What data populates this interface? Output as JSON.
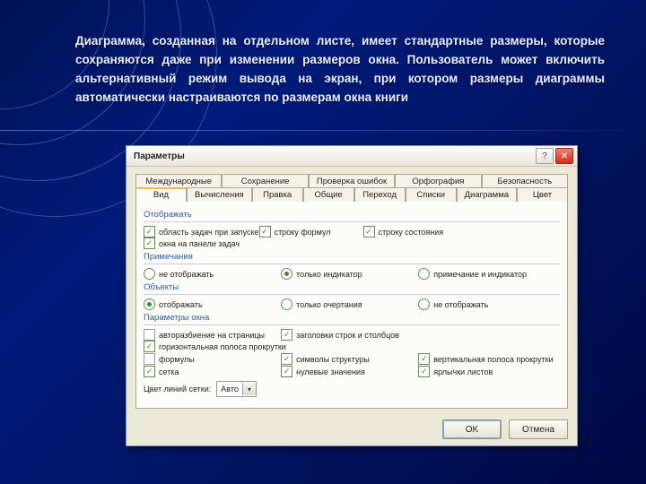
{
  "caption": "Диаграмма, созданная на отдельном листе, имеет стандартные размеры, которые сохраняются даже при изменении размеров окна. Пользователь может включить альтернативный режим вывода на экран, при котором размеры диаграммы автоматически настраиваются по размерам окна книги",
  "dialog": {
    "title": "Параметры",
    "help": "?",
    "close": "✕",
    "tabs_row1": [
      "Международные",
      "Сохранение",
      "Проверка ошибок",
      "Орфография",
      "Безопасность"
    ],
    "tabs_row2": [
      "Вид",
      "Вычисления",
      "Правка",
      "Общие",
      "Переход",
      "Списки",
      "Диаграмма",
      "Цвет"
    ],
    "active_tab": "Вид",
    "groups": {
      "g1": {
        "title": "Отображать",
        "opts": [
          "область задач при запуске",
          "строку формул",
          "строку состояния",
          "окна на панели задач"
        ]
      },
      "g2": {
        "title": "Примечания",
        "opts": [
          "не отображать",
          "только индикатор",
          "примечание и индикатор"
        ]
      },
      "g3": {
        "title": "Объекты",
        "opts": [
          "отображать",
          "только очертания",
          "не отображать"
        ]
      },
      "g4": {
        "title": "Параметры окна",
        "opts": [
          "авторазбиение на страницы",
          "заголовки строк и столбцов",
          "горизонтальная полоса прокрутки",
          "формулы",
          "символы структуры",
          "вертикальная полоса прокрутки",
          "сетка",
          "нулевые значения",
          "ярлычки листов"
        ]
      }
    },
    "color_label": "Цвет линий сетки:",
    "color_value": "Авто",
    "ok": "OK",
    "cancel": "Отмена"
  }
}
